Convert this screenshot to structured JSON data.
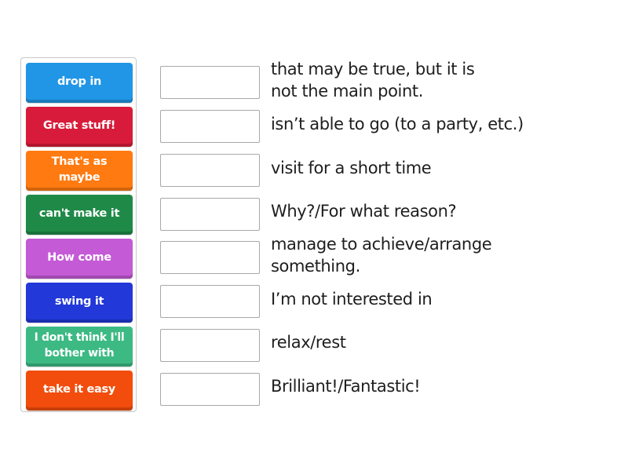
{
  "tiles": [
    {
      "label": "drop in",
      "color": "#2196e6"
    },
    {
      "label": "Great stuff!",
      "color": "#d81b3a"
    },
    {
      "label": "That's as maybe",
      "color": "#ff7a10"
    },
    {
      "label": "can't make it",
      "color": "#1f8a48"
    },
    {
      "label": "How come",
      "color": "#c45ad6"
    },
    {
      "label": "swing it",
      "color": "#2238d8"
    },
    {
      "label": "I don't think I'll bother with",
      "color": "#3dba84"
    },
    {
      "label": "take it easy",
      "color": "#f24d0c"
    }
  ],
  "rows": [
    {
      "answer": "",
      "definition": "that may be true, but it is not the main point."
    },
    {
      "answer": "",
      "definition": "isn’t able to go (to a party, etc.)"
    },
    {
      "answer": "",
      "definition": "visit for a short time"
    },
    {
      "answer": "",
      "definition": "Why?/For what reason?"
    },
    {
      "answer": "",
      "definition": "manage to achieve/arrange something."
    },
    {
      "answer": "",
      "definition": "I’m not interested in"
    },
    {
      "answer": "",
      "definition": "relax/rest"
    },
    {
      "answer": "",
      "definition": "Brilliant!/Fantastic!"
    }
  ]
}
